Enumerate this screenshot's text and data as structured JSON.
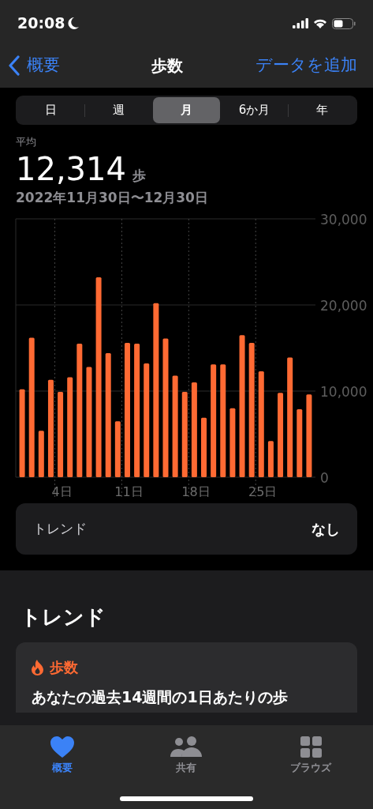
{
  "status_bar": {
    "time": "20:08"
  },
  "nav": {
    "back": "概要",
    "title": "歩数",
    "action": "データを追加"
  },
  "segments": [
    {
      "label": "日",
      "selected": false
    },
    {
      "label": "週",
      "selected": false
    },
    {
      "label": "月",
      "selected": true
    },
    {
      "label": "6か月",
      "selected": false
    },
    {
      "label": "年",
      "selected": false
    }
  ],
  "summary": {
    "label": "平均",
    "value": "12,314",
    "unit": "歩",
    "date_range": "2022年11月30日〜12月30日"
  },
  "chart_data": {
    "type": "bar",
    "categories": [
      null,
      null,
      null,
      null,
      "4日",
      null,
      null,
      null,
      null,
      null,
      null,
      "11日",
      null,
      null,
      null,
      null,
      null,
      null,
      "18日",
      null,
      null,
      null,
      null,
      null,
      null,
      "25日",
      null,
      null,
      null,
      null,
      null
    ],
    "series": [
      {
        "color": "#ff6a33",
        "values": [
          10200,
          16200,
          5400,
          11300,
          9900,
          11600,
          15500,
          12800,
          23200,
          14400,
          6500,
          15600,
          15500,
          13200,
          20200,
          16100,
          11800,
          9900,
          11000,
          6900,
          13100,
          13100,
          8000,
          16500,
          15600,
          12300,
          4200,
          9800,
          13900,
          7900,
          9600
        ]
      }
    ],
    "ylim": [
      0,
      30000
    ],
    "grid": true,
    "yticks": [
      {
        "value": 0,
        "label": "0"
      },
      {
        "value": 10000,
        "label": "10,000"
      },
      {
        "value": 20000,
        "label": "20,000"
      },
      {
        "value": 30000,
        "label": "30,000"
      }
    ]
  },
  "trend_row": {
    "label": "トレンド",
    "value": "なし"
  },
  "trends": {
    "heading": "トレンド",
    "card_title": "歩数",
    "text": "あなたの過去14週間の1日あたりの歩"
  },
  "tab_bar": [
    {
      "label": "概要",
      "kind": "heart",
      "selected": true
    },
    {
      "label": "共有",
      "kind": "people",
      "selected": false
    },
    {
      "label": "ブラウズ",
      "kind": "grid",
      "selected": false
    }
  ]
}
